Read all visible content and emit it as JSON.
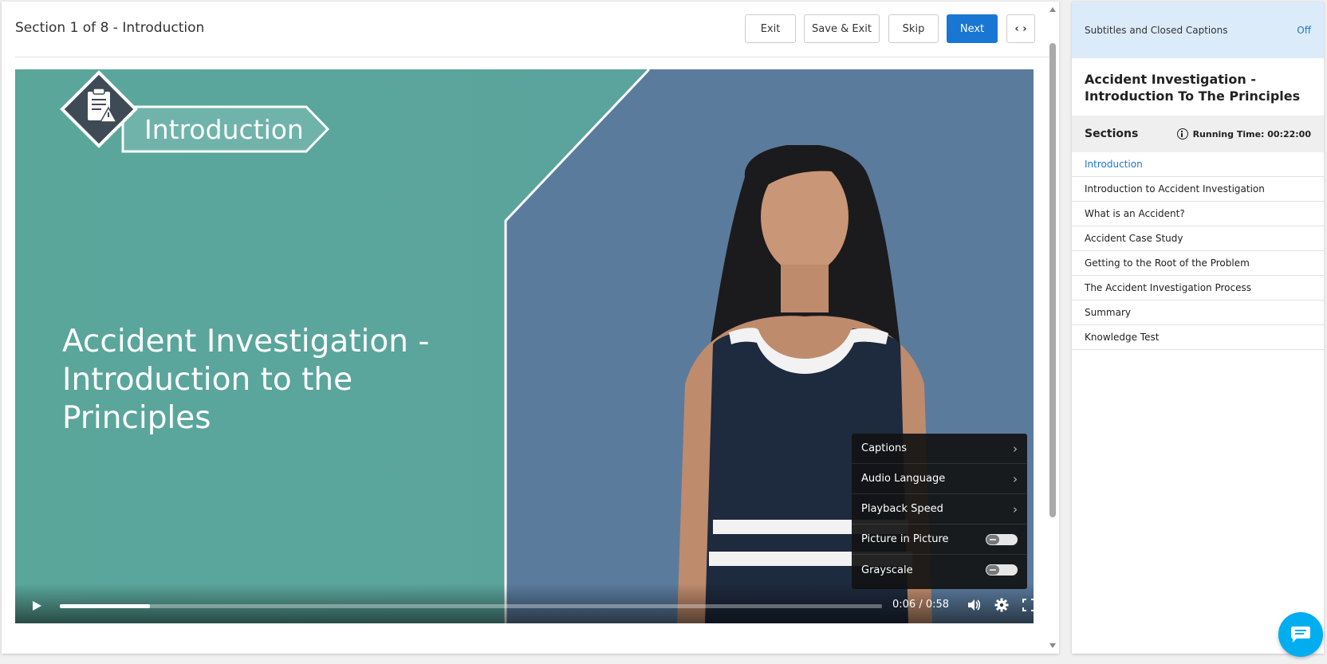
{
  "header": {
    "section_title": "Section 1 of 8 - Introduction",
    "exit_label": "Exit",
    "save_exit_label": "Save & Exit",
    "skip_label": "Skip",
    "next_label": "Next",
    "toggle_label": "‹ ›"
  },
  "video": {
    "badge_label": "Introduction",
    "title_line1": "Accident Investigation -",
    "title_line2": "Introduction to the Principles",
    "time_current": "0:06",
    "time_total": "0:58",
    "progress_fraction": 0.11,
    "settings_menu": [
      {
        "label": "Captions",
        "type": "submenu"
      },
      {
        "label": "Audio Language",
        "type": "submenu"
      },
      {
        "label": "Playback Speed",
        "type": "submenu"
      },
      {
        "label": "Picture in Picture",
        "type": "toggle",
        "on": false
      },
      {
        "label": "Grayscale",
        "type": "toggle",
        "on": false
      }
    ]
  },
  "side": {
    "cc_label": "Subtitles and Closed Captions",
    "cc_state": "Off",
    "course_title": "Accident Investigation - Introduction To The Principles",
    "sections_label": "Sections",
    "running_time": "Running Time: 00:22:00",
    "sections": [
      {
        "label": "Introduction",
        "active": true
      },
      {
        "label": "Introduction to Accident Investigation",
        "active": false
      },
      {
        "label": "What is an Accident?",
        "active": false
      },
      {
        "label": "Accident Case Study",
        "active": false
      },
      {
        "label": "Getting to the Root of the Problem",
        "active": false
      },
      {
        "label": "The Accident Investigation Process",
        "active": false
      },
      {
        "label": "Summary",
        "active": false
      },
      {
        "label": "Knowledge Test",
        "active": false
      }
    ]
  },
  "colors": {
    "accent": "#1976d2",
    "teal_slide": "#5aa39a",
    "blue_slide": "#5b7b9d",
    "cc_bar": "#dcebf9",
    "chat_fab": "#00aeef"
  },
  "icons": [
    "clipboard-warning-icon",
    "play-icon",
    "volume-icon",
    "gear-icon",
    "fullscreen-icon",
    "info-icon",
    "chat-icon",
    "chevron-right-icon"
  ]
}
